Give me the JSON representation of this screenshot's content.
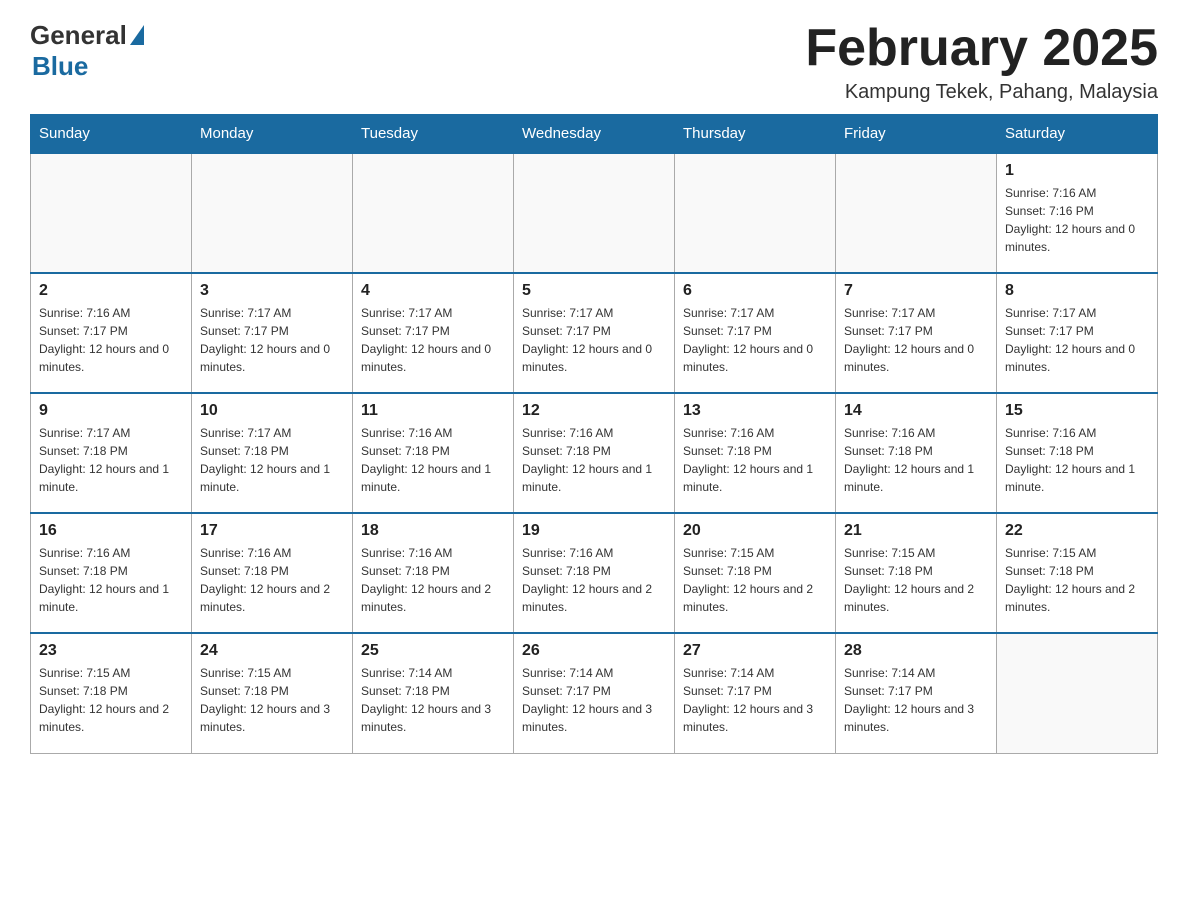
{
  "header": {
    "logo_general": "General",
    "logo_blue": "Blue",
    "month_title": "February 2025",
    "location": "Kampung Tekek, Pahang, Malaysia"
  },
  "weekdays": [
    "Sunday",
    "Monday",
    "Tuesday",
    "Wednesday",
    "Thursday",
    "Friday",
    "Saturday"
  ],
  "weeks": [
    [
      {
        "day": "",
        "sunrise": "",
        "sunset": "",
        "daylight": ""
      },
      {
        "day": "",
        "sunrise": "",
        "sunset": "",
        "daylight": ""
      },
      {
        "day": "",
        "sunrise": "",
        "sunset": "",
        "daylight": ""
      },
      {
        "day": "",
        "sunrise": "",
        "sunset": "",
        "daylight": ""
      },
      {
        "day": "",
        "sunrise": "",
        "sunset": "",
        "daylight": ""
      },
      {
        "day": "",
        "sunrise": "",
        "sunset": "",
        "daylight": ""
      },
      {
        "day": "1",
        "sunrise": "Sunrise: 7:16 AM",
        "sunset": "Sunset: 7:16 PM",
        "daylight": "Daylight: 12 hours and 0 minutes."
      }
    ],
    [
      {
        "day": "2",
        "sunrise": "Sunrise: 7:16 AM",
        "sunset": "Sunset: 7:17 PM",
        "daylight": "Daylight: 12 hours and 0 minutes."
      },
      {
        "day": "3",
        "sunrise": "Sunrise: 7:17 AM",
        "sunset": "Sunset: 7:17 PM",
        "daylight": "Daylight: 12 hours and 0 minutes."
      },
      {
        "day": "4",
        "sunrise": "Sunrise: 7:17 AM",
        "sunset": "Sunset: 7:17 PM",
        "daylight": "Daylight: 12 hours and 0 minutes."
      },
      {
        "day": "5",
        "sunrise": "Sunrise: 7:17 AM",
        "sunset": "Sunset: 7:17 PM",
        "daylight": "Daylight: 12 hours and 0 minutes."
      },
      {
        "day": "6",
        "sunrise": "Sunrise: 7:17 AM",
        "sunset": "Sunset: 7:17 PM",
        "daylight": "Daylight: 12 hours and 0 minutes."
      },
      {
        "day": "7",
        "sunrise": "Sunrise: 7:17 AM",
        "sunset": "Sunset: 7:17 PM",
        "daylight": "Daylight: 12 hours and 0 minutes."
      },
      {
        "day": "8",
        "sunrise": "Sunrise: 7:17 AM",
        "sunset": "Sunset: 7:17 PM",
        "daylight": "Daylight: 12 hours and 0 minutes."
      }
    ],
    [
      {
        "day": "9",
        "sunrise": "Sunrise: 7:17 AM",
        "sunset": "Sunset: 7:18 PM",
        "daylight": "Daylight: 12 hours and 1 minute."
      },
      {
        "day": "10",
        "sunrise": "Sunrise: 7:17 AM",
        "sunset": "Sunset: 7:18 PM",
        "daylight": "Daylight: 12 hours and 1 minute."
      },
      {
        "day": "11",
        "sunrise": "Sunrise: 7:16 AM",
        "sunset": "Sunset: 7:18 PM",
        "daylight": "Daylight: 12 hours and 1 minute."
      },
      {
        "day": "12",
        "sunrise": "Sunrise: 7:16 AM",
        "sunset": "Sunset: 7:18 PM",
        "daylight": "Daylight: 12 hours and 1 minute."
      },
      {
        "day": "13",
        "sunrise": "Sunrise: 7:16 AM",
        "sunset": "Sunset: 7:18 PM",
        "daylight": "Daylight: 12 hours and 1 minute."
      },
      {
        "day": "14",
        "sunrise": "Sunrise: 7:16 AM",
        "sunset": "Sunset: 7:18 PM",
        "daylight": "Daylight: 12 hours and 1 minute."
      },
      {
        "day": "15",
        "sunrise": "Sunrise: 7:16 AM",
        "sunset": "Sunset: 7:18 PM",
        "daylight": "Daylight: 12 hours and 1 minute."
      }
    ],
    [
      {
        "day": "16",
        "sunrise": "Sunrise: 7:16 AM",
        "sunset": "Sunset: 7:18 PM",
        "daylight": "Daylight: 12 hours and 1 minute."
      },
      {
        "day": "17",
        "sunrise": "Sunrise: 7:16 AM",
        "sunset": "Sunset: 7:18 PM",
        "daylight": "Daylight: 12 hours and 2 minutes."
      },
      {
        "day": "18",
        "sunrise": "Sunrise: 7:16 AM",
        "sunset": "Sunset: 7:18 PM",
        "daylight": "Daylight: 12 hours and 2 minutes."
      },
      {
        "day": "19",
        "sunrise": "Sunrise: 7:16 AM",
        "sunset": "Sunset: 7:18 PM",
        "daylight": "Daylight: 12 hours and 2 minutes."
      },
      {
        "day": "20",
        "sunrise": "Sunrise: 7:15 AM",
        "sunset": "Sunset: 7:18 PM",
        "daylight": "Daylight: 12 hours and 2 minutes."
      },
      {
        "day": "21",
        "sunrise": "Sunrise: 7:15 AM",
        "sunset": "Sunset: 7:18 PM",
        "daylight": "Daylight: 12 hours and 2 minutes."
      },
      {
        "day": "22",
        "sunrise": "Sunrise: 7:15 AM",
        "sunset": "Sunset: 7:18 PM",
        "daylight": "Daylight: 12 hours and 2 minutes."
      }
    ],
    [
      {
        "day": "23",
        "sunrise": "Sunrise: 7:15 AM",
        "sunset": "Sunset: 7:18 PM",
        "daylight": "Daylight: 12 hours and 2 minutes."
      },
      {
        "day": "24",
        "sunrise": "Sunrise: 7:15 AM",
        "sunset": "Sunset: 7:18 PM",
        "daylight": "Daylight: 12 hours and 3 minutes."
      },
      {
        "day": "25",
        "sunrise": "Sunrise: 7:14 AM",
        "sunset": "Sunset: 7:18 PM",
        "daylight": "Daylight: 12 hours and 3 minutes."
      },
      {
        "day": "26",
        "sunrise": "Sunrise: 7:14 AM",
        "sunset": "Sunset: 7:17 PM",
        "daylight": "Daylight: 12 hours and 3 minutes."
      },
      {
        "day": "27",
        "sunrise": "Sunrise: 7:14 AM",
        "sunset": "Sunset: 7:17 PM",
        "daylight": "Daylight: 12 hours and 3 minutes."
      },
      {
        "day": "28",
        "sunrise": "Sunrise: 7:14 AM",
        "sunset": "Sunset: 7:17 PM",
        "daylight": "Daylight: 12 hours and 3 minutes."
      },
      {
        "day": "",
        "sunrise": "",
        "sunset": "",
        "daylight": ""
      }
    ]
  ]
}
